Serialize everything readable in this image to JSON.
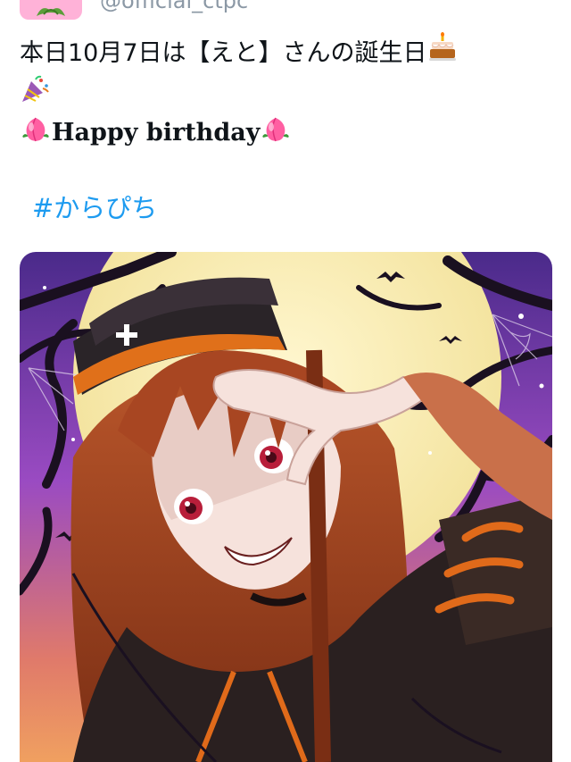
{
  "tweet": {
    "handle": "@official_ctpc",
    "line1": "本日10月7日は【えと】さんの誕生日",
    "line3": "Happy birthday",
    "hashtag": "#からぴち"
  },
  "icons": {
    "avatar": "leaf-logo-icon",
    "cake": "birthday-cake-icon",
    "party": "party-popper-icon",
    "peach": "peach-icon"
  },
  "colors": {
    "hashtag": "#1d9bf0",
    "handle": "#8b98a5",
    "avatar_bg": "#ffb2d8"
  }
}
